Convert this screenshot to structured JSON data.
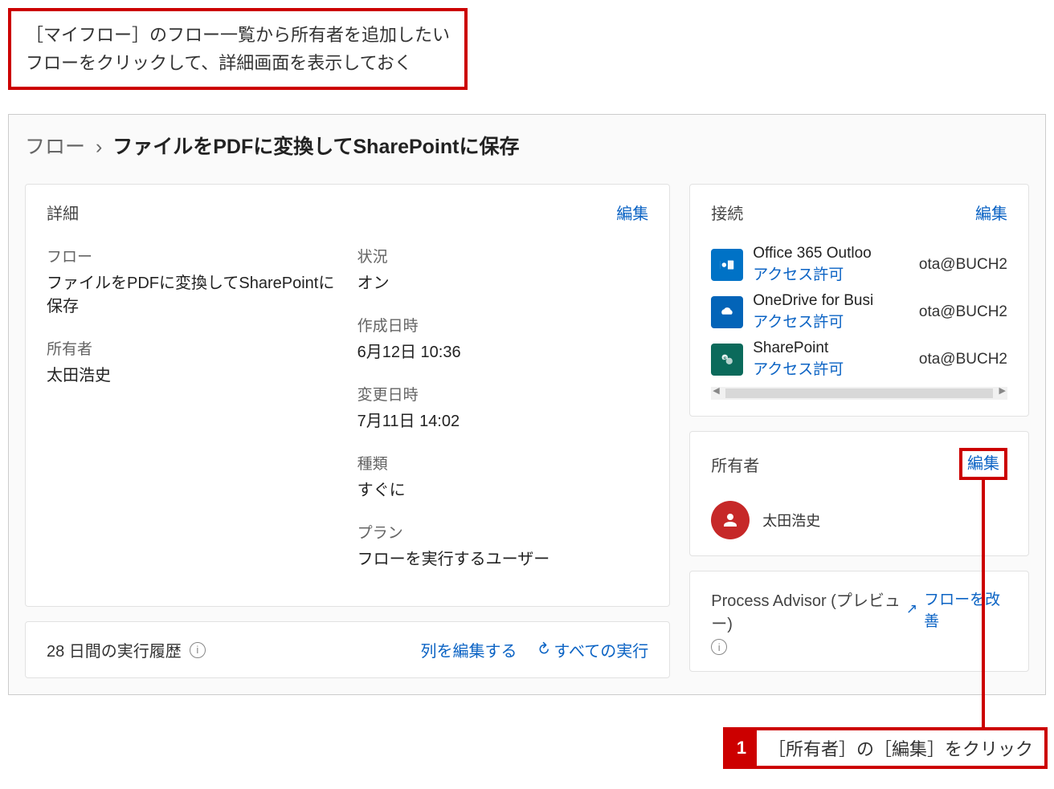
{
  "instruction": {
    "line1": "［マイフロー］のフロー一覧から所有者を追加したい",
    "line2": "フローをクリックして、詳細画面を表示しておく"
  },
  "breadcrumb": {
    "root": "フロー",
    "separator": "›",
    "current": "ファイルをPDFに変換してSharePointに保存"
  },
  "details": {
    "panel_title": "詳細",
    "edit_label": "編集",
    "fields": {
      "flow": {
        "label": "フロー",
        "value": "ファイルをPDFに変換してSharePointに保存"
      },
      "owner": {
        "label": "所有者",
        "value": "太田浩史"
      },
      "status": {
        "label": "状況",
        "value": "オン"
      },
      "created": {
        "label": "作成日時",
        "value": "6月12日 10:36"
      },
      "modified": {
        "label": "変更日時",
        "value": "7月11日 14:02"
      },
      "type": {
        "label": "種類",
        "value": "すぐに"
      },
      "plan": {
        "label": "プラン",
        "value": "フローを実行するユーザー"
      }
    }
  },
  "connections": {
    "panel_title": "接続",
    "edit_label": "編集",
    "permission_label": "アクセス許可",
    "items": [
      {
        "name": "Office 365 Outloo",
        "account": "ota@BUCH2"
      },
      {
        "name": "OneDrive for Busi",
        "account": "ota@BUCH2"
      },
      {
        "name": "SharePoint",
        "account": "ota@BUCH2"
      }
    ]
  },
  "owners": {
    "panel_title": "所有者",
    "edit_label": "編集",
    "name": "太田浩史"
  },
  "process_advisor": {
    "title": "Process Advisor (プレビュー)",
    "improve_label": "フローを改善"
  },
  "history": {
    "title": "28 日間の実行履歴",
    "edit_columns": "列を編集する",
    "all_runs": "すべての実行"
  },
  "callout": {
    "number": "1",
    "text": "［所有者］の［編集］をクリック"
  }
}
